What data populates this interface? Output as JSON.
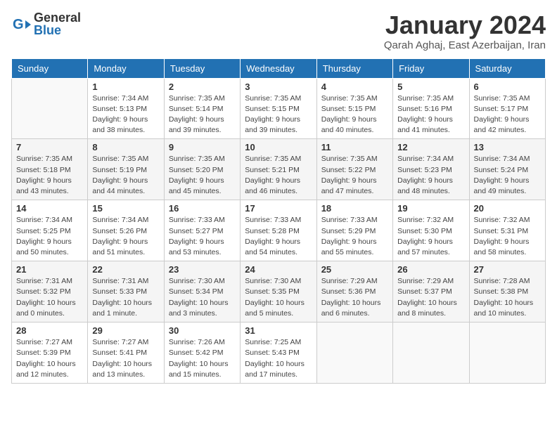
{
  "logo": {
    "text_general": "General",
    "text_blue": "Blue"
  },
  "title": "January 2024",
  "subtitle": "Qarah Aghaj, East Azerbaijan, Iran",
  "weekdays": [
    "Sunday",
    "Monday",
    "Tuesday",
    "Wednesday",
    "Thursday",
    "Friday",
    "Saturday"
  ],
  "weeks": [
    [
      {
        "day": "",
        "info": ""
      },
      {
        "day": "1",
        "info": "Sunrise: 7:34 AM\nSunset: 5:13 PM\nDaylight: 9 hours\nand 38 minutes."
      },
      {
        "day": "2",
        "info": "Sunrise: 7:35 AM\nSunset: 5:14 PM\nDaylight: 9 hours\nand 39 minutes."
      },
      {
        "day": "3",
        "info": "Sunrise: 7:35 AM\nSunset: 5:15 PM\nDaylight: 9 hours\nand 39 minutes."
      },
      {
        "day": "4",
        "info": "Sunrise: 7:35 AM\nSunset: 5:15 PM\nDaylight: 9 hours\nand 40 minutes."
      },
      {
        "day": "5",
        "info": "Sunrise: 7:35 AM\nSunset: 5:16 PM\nDaylight: 9 hours\nand 41 minutes."
      },
      {
        "day": "6",
        "info": "Sunrise: 7:35 AM\nSunset: 5:17 PM\nDaylight: 9 hours\nand 42 minutes."
      }
    ],
    [
      {
        "day": "7",
        "info": "Sunrise: 7:35 AM\nSunset: 5:18 PM\nDaylight: 9 hours\nand 43 minutes."
      },
      {
        "day": "8",
        "info": "Sunrise: 7:35 AM\nSunset: 5:19 PM\nDaylight: 9 hours\nand 44 minutes."
      },
      {
        "day": "9",
        "info": "Sunrise: 7:35 AM\nSunset: 5:20 PM\nDaylight: 9 hours\nand 45 minutes."
      },
      {
        "day": "10",
        "info": "Sunrise: 7:35 AM\nSunset: 5:21 PM\nDaylight: 9 hours\nand 46 minutes."
      },
      {
        "day": "11",
        "info": "Sunrise: 7:35 AM\nSunset: 5:22 PM\nDaylight: 9 hours\nand 47 minutes."
      },
      {
        "day": "12",
        "info": "Sunrise: 7:34 AM\nSunset: 5:23 PM\nDaylight: 9 hours\nand 48 minutes."
      },
      {
        "day": "13",
        "info": "Sunrise: 7:34 AM\nSunset: 5:24 PM\nDaylight: 9 hours\nand 49 minutes."
      }
    ],
    [
      {
        "day": "14",
        "info": "Sunrise: 7:34 AM\nSunset: 5:25 PM\nDaylight: 9 hours\nand 50 minutes."
      },
      {
        "day": "15",
        "info": "Sunrise: 7:34 AM\nSunset: 5:26 PM\nDaylight: 9 hours\nand 51 minutes."
      },
      {
        "day": "16",
        "info": "Sunrise: 7:33 AM\nSunset: 5:27 PM\nDaylight: 9 hours\nand 53 minutes."
      },
      {
        "day": "17",
        "info": "Sunrise: 7:33 AM\nSunset: 5:28 PM\nDaylight: 9 hours\nand 54 minutes."
      },
      {
        "day": "18",
        "info": "Sunrise: 7:33 AM\nSunset: 5:29 PM\nDaylight: 9 hours\nand 55 minutes."
      },
      {
        "day": "19",
        "info": "Sunrise: 7:32 AM\nSunset: 5:30 PM\nDaylight: 9 hours\nand 57 minutes."
      },
      {
        "day": "20",
        "info": "Sunrise: 7:32 AM\nSunset: 5:31 PM\nDaylight: 9 hours\nand 58 minutes."
      }
    ],
    [
      {
        "day": "21",
        "info": "Sunrise: 7:31 AM\nSunset: 5:32 PM\nDaylight: 10 hours\nand 0 minutes."
      },
      {
        "day": "22",
        "info": "Sunrise: 7:31 AM\nSunset: 5:33 PM\nDaylight: 10 hours\nand 1 minute."
      },
      {
        "day": "23",
        "info": "Sunrise: 7:30 AM\nSunset: 5:34 PM\nDaylight: 10 hours\nand 3 minutes."
      },
      {
        "day": "24",
        "info": "Sunrise: 7:30 AM\nSunset: 5:35 PM\nDaylight: 10 hours\nand 5 minutes."
      },
      {
        "day": "25",
        "info": "Sunrise: 7:29 AM\nSunset: 5:36 PM\nDaylight: 10 hours\nand 6 minutes."
      },
      {
        "day": "26",
        "info": "Sunrise: 7:29 AM\nSunset: 5:37 PM\nDaylight: 10 hours\nand 8 minutes."
      },
      {
        "day": "27",
        "info": "Sunrise: 7:28 AM\nSunset: 5:38 PM\nDaylight: 10 hours\nand 10 minutes."
      }
    ],
    [
      {
        "day": "28",
        "info": "Sunrise: 7:27 AM\nSunset: 5:39 PM\nDaylight: 10 hours\nand 12 minutes."
      },
      {
        "day": "29",
        "info": "Sunrise: 7:27 AM\nSunset: 5:41 PM\nDaylight: 10 hours\nand 13 minutes."
      },
      {
        "day": "30",
        "info": "Sunrise: 7:26 AM\nSunset: 5:42 PM\nDaylight: 10 hours\nand 15 minutes."
      },
      {
        "day": "31",
        "info": "Sunrise: 7:25 AM\nSunset: 5:43 PM\nDaylight: 10 hours\nand 17 minutes."
      },
      {
        "day": "",
        "info": ""
      },
      {
        "day": "",
        "info": ""
      },
      {
        "day": "",
        "info": ""
      }
    ]
  ]
}
